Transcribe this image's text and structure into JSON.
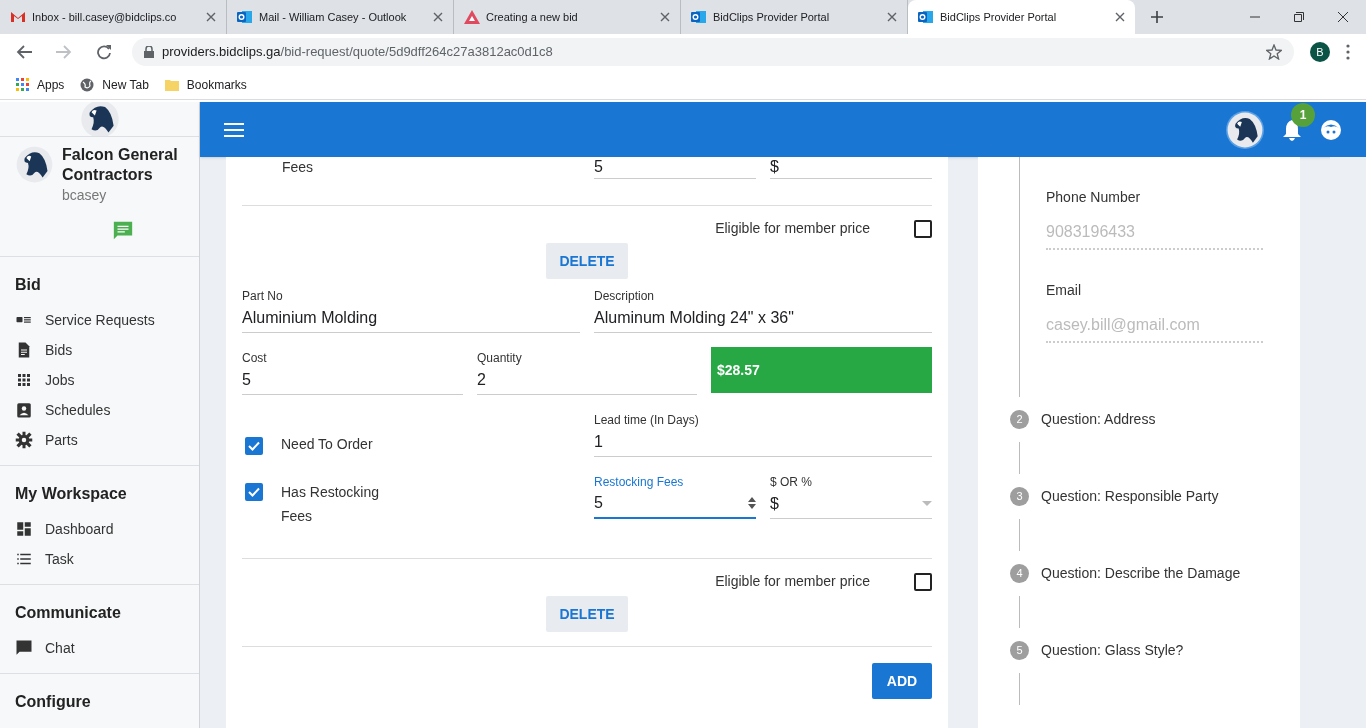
{
  "browser": {
    "tabs": [
      {
        "kind": "gmail",
        "title": "Inbox - bill.casey@bidclips.co",
        "selected": false
      },
      {
        "kind": "outlook",
        "title": "Mail - William Casey - Outlook",
        "selected": false
      },
      {
        "kind": "triangle",
        "title": "Creating a new bid",
        "selected": false
      },
      {
        "kind": "outlook",
        "title": "BidClips Provider Portal",
        "selected": false
      },
      {
        "kind": "outlook",
        "title": "BidClips Provider Portal",
        "selected": true
      }
    ],
    "url_host": "providers.bidclips.ga",
    "url_path": "/bid-request/quote/5d9dff264c27a3812ac0d1c8",
    "profile": "B",
    "bookmarks": [
      {
        "kind": "apps",
        "label": "Apps"
      },
      {
        "kind": "globe",
        "label": "New Tab"
      },
      {
        "kind": "folder",
        "label": "Bookmarks"
      }
    ]
  },
  "sidebar": {
    "company": "Falcon General\nContractors",
    "username": "bcasey",
    "sections": [
      {
        "title": "Bid",
        "items": [
          {
            "kind": "card",
            "label": "Service Requests"
          },
          {
            "kind": "doc",
            "label": "Bids"
          },
          {
            "kind": "grid",
            "label": "Jobs"
          },
          {
            "kind": "contact",
            "label": "Schedules"
          },
          {
            "kind": "gear",
            "label": "Parts"
          }
        ]
      },
      {
        "title": "My Workspace",
        "items": [
          {
            "kind": "dashboard",
            "label": "Dashboard"
          },
          {
            "kind": "list",
            "label": "Task"
          }
        ]
      },
      {
        "title": "Communicate",
        "items": [
          {
            "kind": "chat",
            "label": "Chat"
          }
        ]
      },
      {
        "title": "Configure"
      }
    ]
  },
  "header": {
    "notification_count": "1"
  },
  "top_row": {
    "label": "Fees",
    "restocking": "5",
    "unit": "$"
  },
  "parts": [
    {
      "eligible_label": "Eligible for member price",
      "eligible": false,
      "delete": "DELETE",
      "part_no_label": "Part No",
      "part_no": "Aluminium Molding",
      "description_label": "Description",
      "description": "Aluminum Molding 24\" x 36\"",
      "cost_label": "Cost",
      "cost": "5",
      "quantity_label": "Quantity",
      "quantity": "2",
      "total": "$28.57",
      "need_order_label": "Need To Order",
      "need_order": true,
      "lead_label": "Lead time (In Days)",
      "lead": "1",
      "restock_label": "Has Restocking\nFees",
      "restock": true,
      "restock_fee_label": "Restocking Fees",
      "restock_fee": "5",
      "unit_label": "$ OR %",
      "unit": "$"
    }
  ],
  "last_part": {
    "eligible_label": "Eligible for member price",
    "eligible": false,
    "delete": "DELETE"
  },
  "add": "ADD",
  "contact": [
    {
      "label": "Phone Number",
      "value": "9083196433"
    },
    {
      "label": "Email",
      "value": "casey.bill@gmail.com"
    }
  ],
  "questions": [
    {
      "number": "2",
      "label": "Question: Address"
    },
    {
      "number": "3",
      "label": "Question: Responsible Party"
    },
    {
      "number": "4",
      "label": "Question: Describe the Damage"
    },
    {
      "number": "5",
      "label": "Question: Glass Style?"
    }
  ]
}
